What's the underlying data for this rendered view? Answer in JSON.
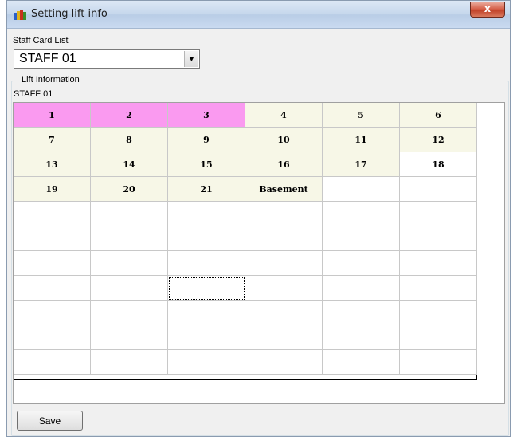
{
  "window": {
    "title": "Setting lift info",
    "close_label": "x",
    "icon": "app-icon"
  },
  "staff_card_list": {
    "label": "Staff Card List",
    "selected": "STAFF 01",
    "dropdown_icon": "chevron-down-icon"
  },
  "lift_information": {
    "legend": "Lift Information",
    "staff_name": "STAFF 01"
  },
  "grid": {
    "columns": 6,
    "rows": [
      [
        "1",
        "2",
        "3",
        "4",
        "5",
        "6"
      ],
      [
        "7",
        "8",
        "9",
        "10",
        "11",
        "12"
      ],
      [
        "13",
        "14",
        "15",
        "16",
        "17",
        "18"
      ],
      [
        "19",
        "20",
        "21",
        "Basement",
        "",
        ""
      ],
      [
        "",
        "",
        "",
        "",
        "",
        ""
      ],
      [
        "",
        "",
        "",
        "",
        "",
        ""
      ],
      [
        "",
        "",
        "",
        "",
        "",
        ""
      ],
      [
        "",
        "",
        "",
        "",
        "",
        ""
      ],
      [
        "",
        "",
        "",
        "",
        "",
        ""
      ],
      [
        "",
        "",
        "",
        "",
        "",
        ""
      ],
      [
        "",
        "",
        "",
        "",
        "",
        ""
      ]
    ],
    "selected_floors": [
      "1",
      "2",
      "3"
    ],
    "available_floors": [
      "4",
      "5",
      "6",
      "7",
      "8",
      "9",
      "10",
      "11",
      "12",
      "13",
      "14",
      "15",
      "16",
      "17",
      "19",
      "20",
      "21",
      "Basement"
    ],
    "focused_cell": {
      "row": 7,
      "col": 2
    },
    "colors": {
      "selected": "#fa9af0",
      "available": "#f7f7e7",
      "empty": "#ffffff"
    }
  },
  "buttons": {
    "save": "Save"
  }
}
